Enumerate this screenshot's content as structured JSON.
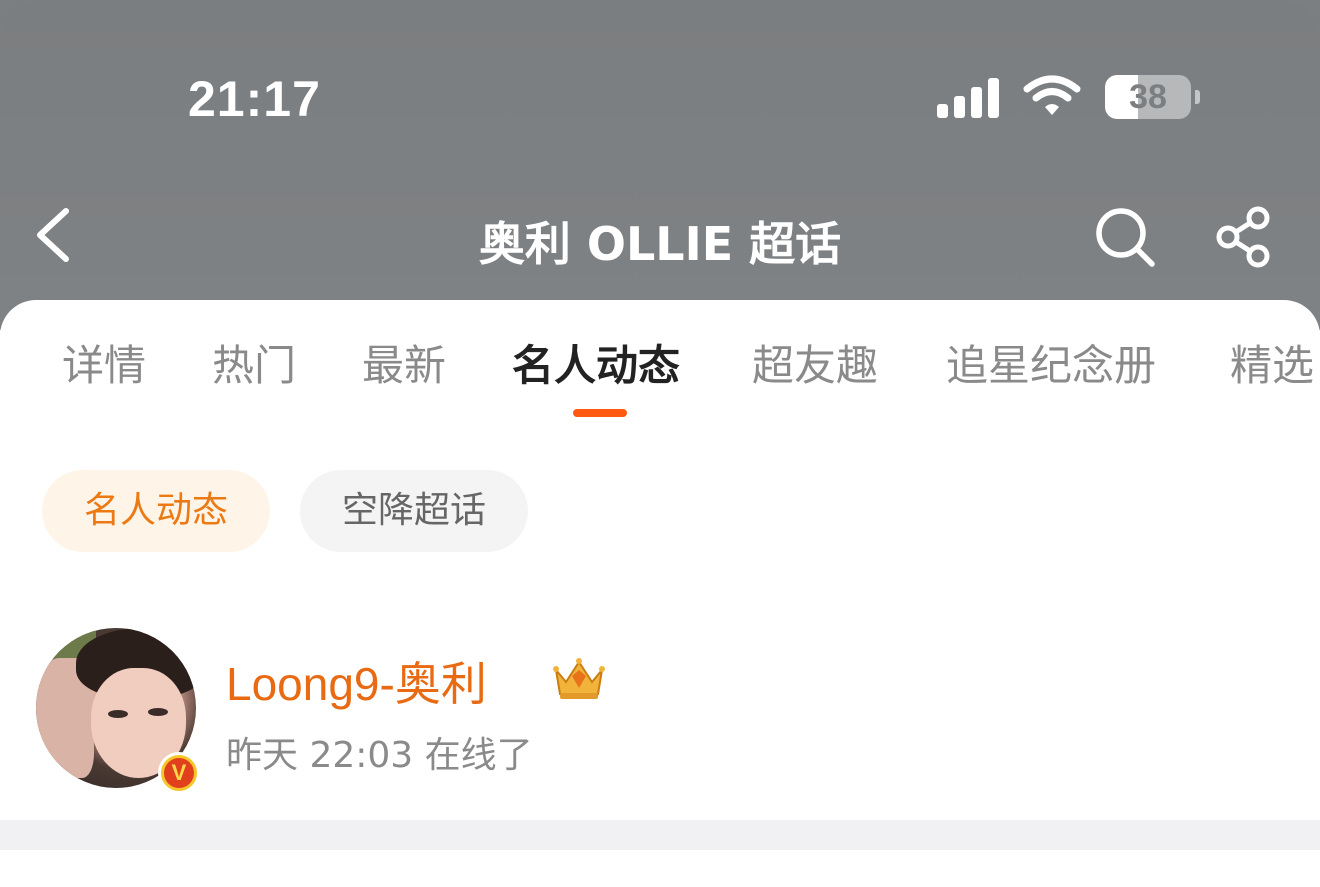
{
  "status_bar": {
    "time": "21:17",
    "battery_level": "38",
    "battery_fraction": 0.38,
    "icons": [
      "signal-icon",
      "wifi-icon",
      "battery-icon"
    ]
  },
  "nav": {
    "title": "奥利 OLLIE 超话",
    "back_icon": "chevron-left-icon",
    "search_icon": "search-icon",
    "share_icon": "share-icon"
  },
  "tabs": [
    {
      "label": "详情"
    },
    {
      "label": "热门"
    },
    {
      "label": "最新"
    },
    {
      "label": "名人动态",
      "active": true
    },
    {
      "label": "超友趣"
    },
    {
      "label": "追星纪念册"
    },
    {
      "label": "精选"
    }
  ],
  "filters": [
    {
      "label": "名人动态",
      "selected": true
    },
    {
      "label": "空降超话",
      "selected": false
    }
  ],
  "user": {
    "name": "Loong9-奥利",
    "status": "昨天 22:03 在线了",
    "badge_icon": "crown-icon",
    "verified_icon": "verified-v-icon",
    "verified_letter": "V"
  },
  "colors": {
    "header_bg": "#7c7f81",
    "accent_orange": "#ff5a10",
    "username_orange": "#e86a12",
    "chip_selected_bg": "#fff4e8",
    "chip_selected_text": "#ec7a14"
  }
}
